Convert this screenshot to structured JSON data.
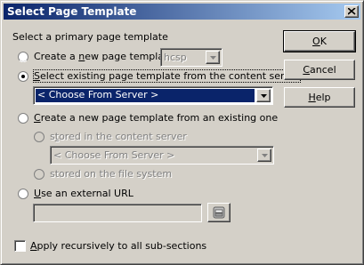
{
  "window": {
    "title": "Select Page Template"
  },
  "group_label": "Select a primary page template",
  "options": {
    "create_new": {
      "label_pre": "Create a ",
      "label_u": "n",
      "label_post": "ew page template",
      "combo_value": "hcsp"
    },
    "select_existing": {
      "label_u": "S",
      "label_post": "elect existing page template from the content server",
      "combo_value": "< Choose From Server >"
    },
    "create_from_existing": {
      "label_u": "C",
      "label_post": "reate a new page template from an existing one"
    },
    "stored_content_server": {
      "label_pre": "s",
      "label_u": "t",
      "label_post": "ored in the content server",
      "combo_value": "< Choose From Server >"
    },
    "stored_file_system": {
      "label": "stored on the file system"
    },
    "external_url": {
      "label_u": "U",
      "label_post": "se an external URL",
      "value": ""
    }
  },
  "apply_recursive": {
    "label_u": "A",
    "label_post": "pply recursively to all sub-sections"
  },
  "buttons": {
    "ok": {
      "label_u": "O",
      "label_post": "K"
    },
    "cancel": {
      "label_u": "C",
      "label_post": "ancel"
    },
    "help": {
      "label_u": "H",
      "label_post": "elp"
    }
  }
}
